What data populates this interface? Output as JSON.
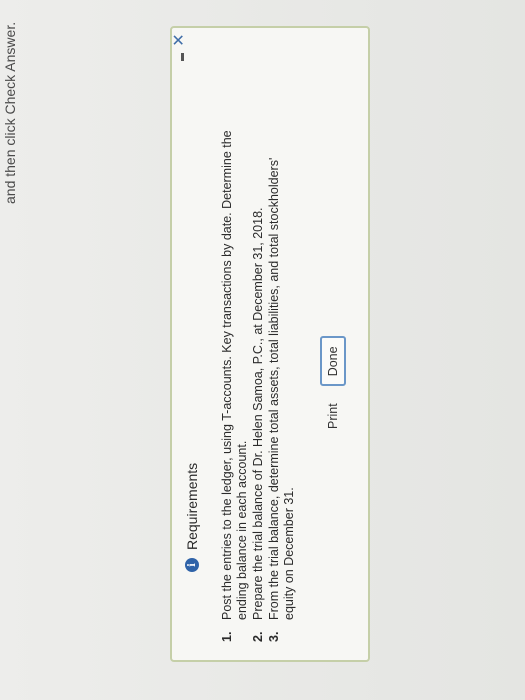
{
  "background_instruction": "and then click Check Answer.",
  "dialog": {
    "title": "Requirements",
    "info_icon_glyph": "i",
    "minimize_label": "–",
    "close_label": "✕",
    "items": [
      {
        "num": "1.",
        "text": "Post the entries to the ledger, using T-accounts. Key transactions by date. Determine the ending balance in each account."
      },
      {
        "num": "2.",
        "text": "Prepare the trial balance of Dr. Helen Samoa, P.C., at December 31, 2018."
      },
      {
        "num": "3.",
        "text": "From the trial balance, determine total assets, total liabilities, and total stockholders' equity on December 31."
      }
    ],
    "print_label": "Print",
    "done_label": "Done"
  },
  "colors": {
    "accent": "#2f63a8",
    "dialog_border": "#c5cfa8",
    "done_border": "#6b97c8"
  }
}
